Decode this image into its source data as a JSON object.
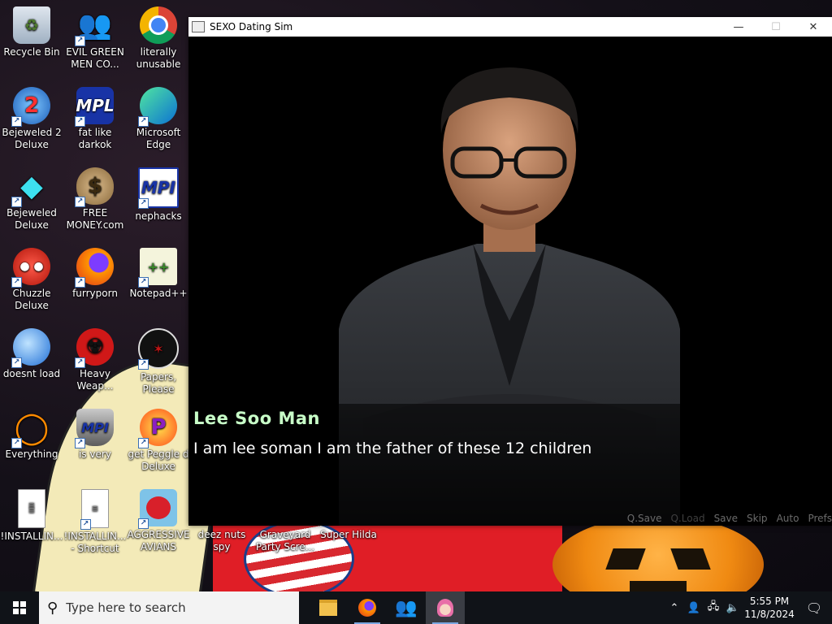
{
  "desktop": {
    "icons": [
      {
        "label": "Recycle Bin",
        "icon": "recycle-bin-icon"
      },
      {
        "label": "EVIL GREEN MEN CO...",
        "icon": "green-men-icon"
      },
      {
        "label": "literally unusable",
        "icon": "chrome-icon"
      },
      {
        "label": "Bejeweled 2 Deluxe",
        "icon": "bejeweled2-icon"
      },
      {
        "label": "fat like darkok",
        "icon": "mpl-icon"
      },
      {
        "label": "Microsoft Edge",
        "icon": "edge-icon"
      },
      {
        "label": "Bejeweled Deluxe",
        "icon": "gem-icon"
      },
      {
        "label": "FREE MONEY.com",
        "icon": "money-bag-icon"
      },
      {
        "label": "nephacks",
        "icon": "mpi-icon"
      },
      {
        "label": "Chuzzle Deluxe",
        "icon": "chuzzle-icon"
      },
      {
        "label": "furryporn",
        "icon": "firefox-icon"
      },
      {
        "label": "Notepad++",
        "icon": "notepadpp-icon"
      },
      {
        "label": "doesnt load",
        "icon": "thunderbird-icon"
      },
      {
        "label": "Heavy Weap...",
        "icon": "radiation-icon"
      },
      {
        "label": "Papers, Please",
        "icon": "papers-please-icon"
      },
      {
        "label": "Everything",
        "icon": "everything-search-icon"
      },
      {
        "label": "is very",
        "icon": "mpi-shield-icon"
      },
      {
        "label": "get Peggle d Deluxe",
        "icon": "peggle-icon"
      },
      {
        "label": "!INSTALLIN...",
        "icon": "text-file-icon"
      },
      {
        "label": "!INSTALLIN... - Shortcut",
        "icon": "text-file-shortcut-icon"
      },
      {
        "label": "AGGRESSIVE AVIANS",
        "icon": "angry-bird-icon"
      },
      {
        "label": "deez nuts spy",
        "icon": "none"
      },
      {
        "label": "Graveyard Party Scre...",
        "icon": "none"
      },
      {
        "label": "Super Hilda",
        "icon": "none"
      }
    ]
  },
  "window": {
    "title": "SEXO Dating Sim",
    "minimize": "—",
    "maximize": "☐",
    "close": "✕"
  },
  "game": {
    "speaker": "Lee Soo Man",
    "speaker_color": "#c8ffc8",
    "dialogue": "I am lee soman I am the father of these 12 children",
    "quick_menu": [
      "Q.Save",
      "Q.Load",
      "Save",
      "Skip",
      "Auto",
      "Prefs"
    ]
  },
  "taskbar": {
    "search_placeholder": "Type here to search",
    "apps": [
      "file-explorer-icon",
      "firefox-icon",
      "green-men-icon",
      "dating-sim-icon"
    ],
    "clock_time": "5:55 PM",
    "clock_date": "11/8/2024"
  }
}
